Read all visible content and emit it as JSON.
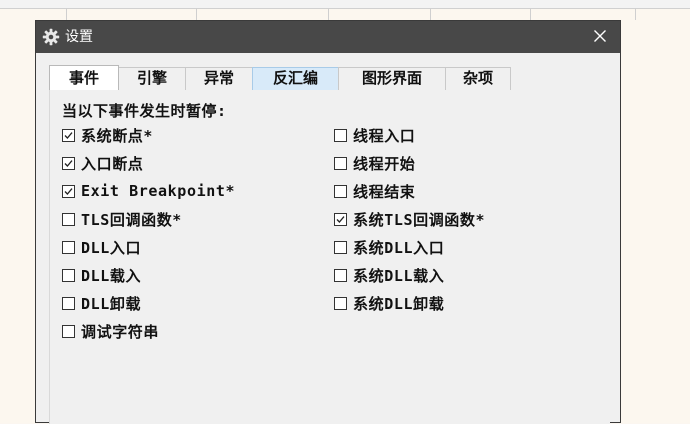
{
  "dialog": {
    "title": "设置",
    "icon": "gear-icon",
    "close_icon": "close-icon"
  },
  "tabs": [
    {
      "label": "事件",
      "active": true
    },
    {
      "label": "引擎",
      "active": false
    },
    {
      "label": "异常",
      "active": false
    },
    {
      "label": "反汇编",
      "active": false,
      "hover": true
    },
    {
      "label": "图形界面",
      "active": false
    },
    {
      "label": "杂项",
      "active": false
    }
  ],
  "events": {
    "section_label": "当以下事件发生时暂停:",
    "left_column": [
      {
        "label": "系统断点*",
        "checked": true
      },
      {
        "label": "入口断点",
        "checked": true
      },
      {
        "label": "Exit Breakpoint*",
        "checked": true
      },
      {
        "label": "TLS回调函数*",
        "checked": false
      },
      {
        "label": "DLL入口",
        "checked": false
      },
      {
        "label": "DLL载入",
        "checked": false
      },
      {
        "label": "DLL卸载",
        "checked": false
      },
      {
        "label": "调试字符串",
        "checked": false
      }
    ],
    "right_column": [
      {
        "label": "线程入口",
        "checked": false
      },
      {
        "label": "线程开始",
        "checked": false
      },
      {
        "label": "线程结束",
        "checked": false
      },
      {
        "label": "系统TLS回调函数*",
        "checked": true
      },
      {
        "label": "系统DLL入口",
        "checked": false
      },
      {
        "label": "系统DLL载入",
        "checked": false
      },
      {
        "label": "系统DLL卸载",
        "checked": false
      }
    ]
  },
  "colors": {
    "titlebar": "#484848",
    "dialog_bg": "#f0f0f0",
    "tab_hover": "#d8eaf9"
  }
}
